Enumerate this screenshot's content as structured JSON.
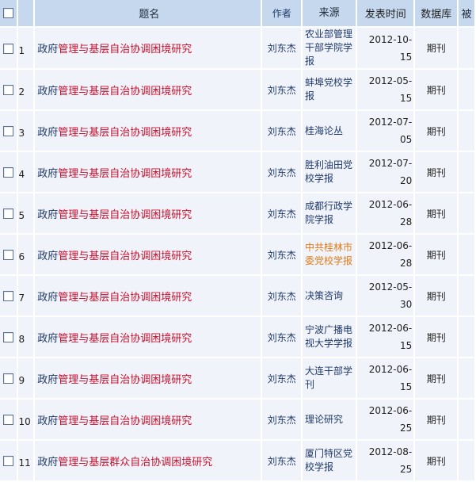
{
  "headers": {
    "select": "",
    "title": "题名",
    "author": "作者",
    "source": "来源",
    "date": "发表时间",
    "database": "数据库",
    "extra": "被"
  },
  "rows": [
    {
      "num": "1",
      "title_pre": "政府",
      "title_hl": "管理与基层自治协调困境研究",
      "author": "刘东杰",
      "source": "农业部管理干部学院学报",
      "source_highlight": false,
      "date_ym": "2012-10-",
      "date_d": "15",
      "database": "期刊"
    },
    {
      "num": "2",
      "title_pre": "政府",
      "title_hl": "管理与基层自治协调困境研究",
      "author": "刘东杰",
      "source": "蚌埠党校学报",
      "source_highlight": false,
      "date_ym": "2012-05-",
      "date_d": "15",
      "database": "期刊"
    },
    {
      "num": "3",
      "title_pre": "政府",
      "title_hl": "管理与基层自治协调困境研究",
      "author": "刘东杰",
      "source": "桂海论丛",
      "source_highlight": false,
      "date_ym": "2012-07-",
      "date_d": "05",
      "database": "期刊"
    },
    {
      "num": "4",
      "title_pre": "政府",
      "title_hl": "管理与基层自治协调困境研究",
      "author": "刘东杰",
      "source": "胜利油田党校学报",
      "source_highlight": false,
      "date_ym": "2012-07-",
      "date_d": "20",
      "database": "期刊"
    },
    {
      "num": "5",
      "title_pre": "政府",
      "title_hl": "管理与基层自治协调困境研究",
      "author": "刘东杰",
      "source": "成都行政学院学报",
      "source_highlight": false,
      "date_ym": "2012-06-",
      "date_d": "28",
      "database": "期刊"
    },
    {
      "num": "6",
      "title_pre": "政府",
      "title_hl": "管理与基层自治协调困境研究",
      "author": "刘东杰",
      "source": "中共桂林市委党校学报",
      "source_highlight": true,
      "date_ym": "2012-06-",
      "date_d": "28",
      "database": "期刊"
    },
    {
      "num": "7",
      "title_pre": "政府",
      "title_hl": "管理与基层自治协调困境研究",
      "author": "刘东杰",
      "source": "决策咨询",
      "source_highlight": false,
      "date_ym": "2012-05-",
      "date_d": "30",
      "database": "期刊"
    },
    {
      "num": "8",
      "title_pre": "政府",
      "title_hl": "管理与基层自治协调困境研究",
      "author": "刘东杰",
      "source": "宁波广播电视大学学报",
      "source_highlight": false,
      "date_ym": "2012-06-",
      "date_d": "15",
      "database": "期刊"
    },
    {
      "num": "9",
      "title_pre": "政府",
      "title_hl": "管理与基层自治协调困境研究",
      "author": "刘东杰",
      "source": "大连干部学刊",
      "source_highlight": false,
      "date_ym": "2012-06-",
      "date_d": "15",
      "database": "期刊"
    },
    {
      "num": "10",
      "title_pre": "政府",
      "title_hl": "管理与基层自治协调困境研究",
      "author": "刘东杰",
      "source": "理论研究",
      "source_highlight": false,
      "date_ym": "2012-06-",
      "date_d": "25",
      "database": "期刊"
    },
    {
      "num": "11",
      "title_pre": "政府",
      "title_hl": "管理与基层群众自治协调困境研究",
      "author": "刘东杰",
      "source": "厦门特区党校学报",
      "source_highlight": false,
      "date_ym": "2012-08-",
      "date_d": "25",
      "database": "期刊"
    }
  ]
}
